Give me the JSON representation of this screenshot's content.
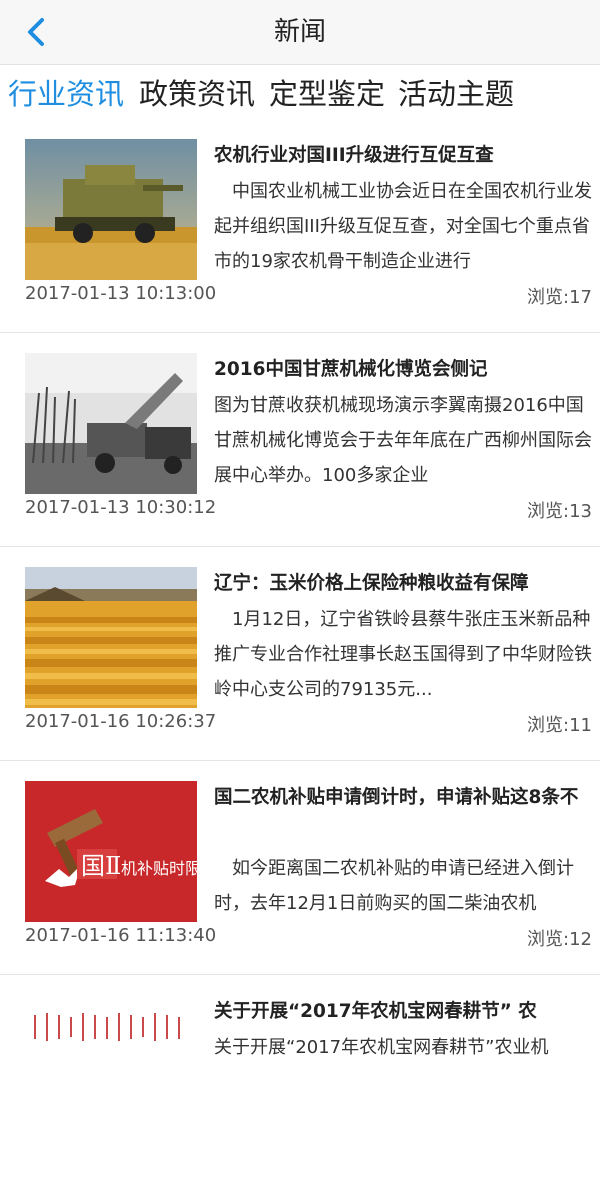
{
  "header": {
    "title": "新闻"
  },
  "tabs": [
    {
      "label": "行业资讯",
      "active": true
    },
    {
      "label": "政策资讯",
      "active": false
    },
    {
      "label": "定型鉴定",
      "active": false
    },
    {
      "label": "活动主题",
      "active": false
    }
  ],
  "colors": {
    "accent": "#1f8ee0"
  },
  "news": [
    {
      "title": "农机行业对国III升级进行互促互查",
      "summary": "　中国农业机械工业协会近日在全国农机行业发起并组织国III升级互促互查，对全国七个重点省市的19家农机骨干制造企业进行",
      "date": "2017-01-13 10:13:00",
      "views": "浏览:17",
      "image": "combine-harvester-photo"
    },
    {
      "title": "2016中国甘蔗机械化博览会侧记",
      "summary": "图为甘蔗收获机械现场演示李翼南摄2016中国甘蔗机械化博览会于去年年底在广西柳州国际会展中心举办。100多家企业",
      "date": "2017-01-13 10:30:12",
      "views": "浏览:13",
      "image": "sugarcane-harvester-photo"
    },
    {
      "title": "辽宁：玉米价格上保险种粮收益有保障",
      "summary": "　1月12日，辽宁省铁岭县蔡牛张庄玉米新品种推广专业合作社理事长赵玉国得到了中华财险铁岭中心支公司的79135元...",
      "date": "2017-01-16 10:26:37",
      "views": "浏览:11",
      "image": "corn-field-photo"
    },
    {
      "title": "国二农机补贴申请倒计时，申请补贴这8条不",
      "summary": "　如今距离国二农机补贴的申请已经进入倒计时，去年12月1日前购买的国二柴油农机",
      "date": "2017-01-16 11:13:40",
      "views": "浏览:12",
      "image": "subsidy-deadline-graphic",
      "image_text": "国Ⅱ机补贴时限"
    },
    {
      "title": "关于开展“2017年农机宝网春耕节” 农",
      "summary": "关于开展“2017年农机宝网春耕节”农业机",
      "image": "calligraphy-banner"
    }
  ]
}
